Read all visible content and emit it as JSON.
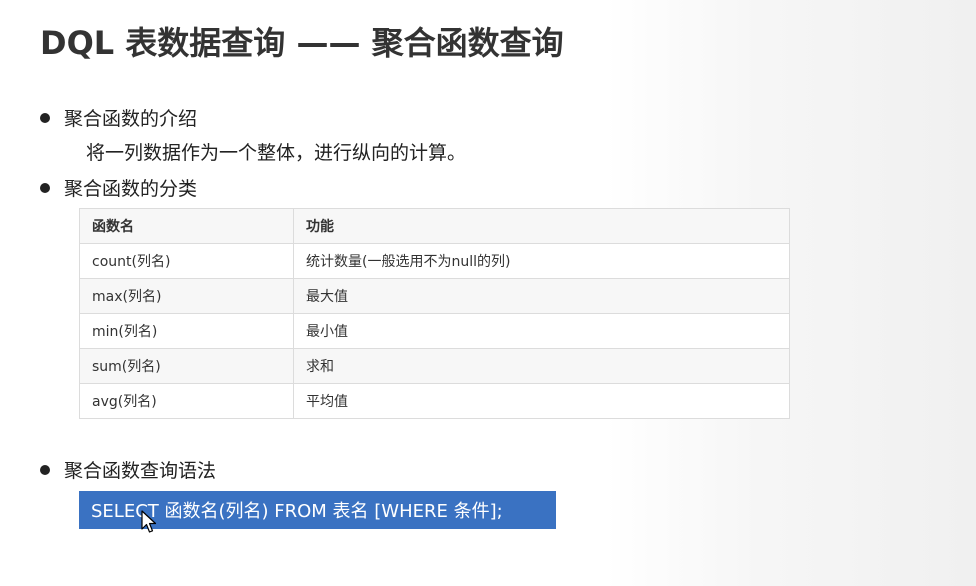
{
  "title": "DQL 表数据查询 —— 聚合函数查询",
  "sections": [
    {
      "heading": "聚合函数的介绍",
      "description": "将一列数据作为一个整体，进行纵向的计算。"
    },
    {
      "heading": "聚合函数的分类"
    },
    {
      "heading": "聚合函数查询语法"
    }
  ],
  "table": {
    "headers": [
      "函数名",
      "功能"
    ],
    "rows": [
      {
        "name": "count(列名)",
        "function": "统计数量(一般选用不为null的列)"
      },
      {
        "name": "max(列名)",
        "function": "最大值"
      },
      {
        "name": "min(列名)",
        "function": "最小值"
      },
      {
        "name": "sum(列名)",
        "function": "求和"
      },
      {
        "name": "avg(列名)",
        "function": "平均值"
      }
    ]
  },
  "syntax": "SELECT 函数名(列名) FROM 表名 [WHERE 条件];",
  "colors": {
    "syntax_bg": "#3a72c2",
    "table_border": "#dcdcdc",
    "stripe": "#f7f7f7"
  },
  "icons": [
    "bullet-dot-icon",
    "mouse-cursor-icon"
  ]
}
